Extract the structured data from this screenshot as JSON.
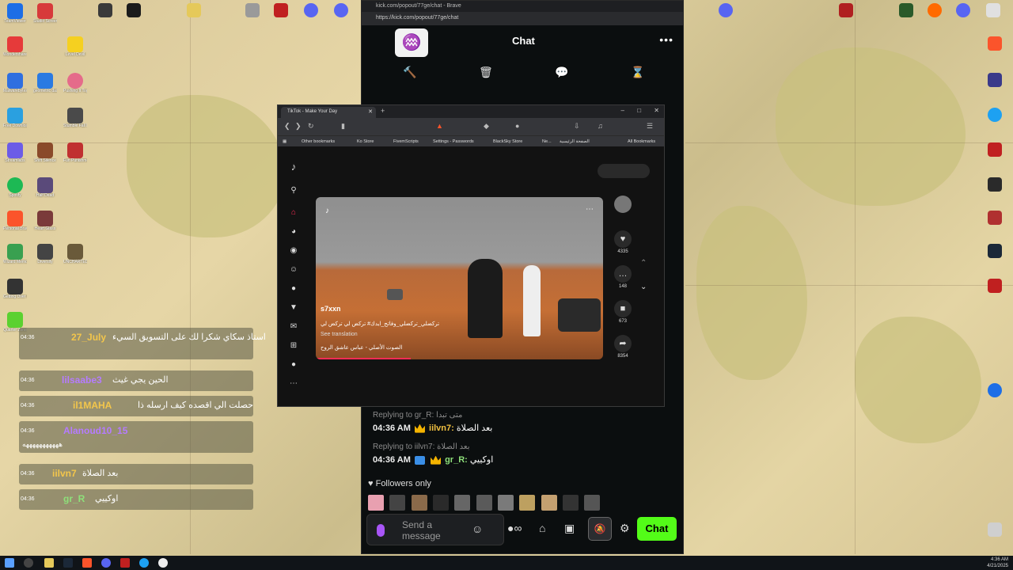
{
  "desktop": {
    "left_icons": [
      {
        "label": "TeamViewer",
        "color": "#1d6ee6"
      },
      {
        "label": "Wondershare PDFelement",
        "color": "#e63a3a"
      },
      {
        "label": "Malwarebytes",
        "color": "#2f6fe0"
      },
      {
        "label": "Free Download",
        "color": "#2aa0e0"
      },
      {
        "label": "Streamlabs",
        "color": "#6c5ce7"
      },
      {
        "label": "Spotify",
        "color": "#1db954"
      },
      {
        "label": "Personal Brave",
        "color": "#fb542b"
      },
      {
        "label": "Wizard Memories",
        "color": "#39a050"
      },
      {
        "label": "Getting Over It with Bennett",
        "color": "#333333"
      },
      {
        "label": "Quarter Zone",
        "color": "#5bd130"
      }
    ],
    "second_icons": [
      {
        "label": "Studio Screen",
        "color": "#d73a3a"
      },
      {
        "label": "Level Devil",
        "color": "#f5d020"
      },
      {
        "label": "geometric dash",
        "color": "#2a7ae2"
      },
      {
        "label": "Pushing It Together",
        "color": "#e56b8a"
      },
      {
        "label": "Stumble Fall Hero",
        "color": "#4a4a4a"
      },
      {
        "label": "Shift Silence",
        "color": "#8a4a2a"
      },
      {
        "label": "Fun Punishment",
        "color": "#c03030"
      },
      {
        "label": "Half Dead",
        "color": "#5a4a7a"
      },
      {
        "label": "Heart Glass",
        "color": "#7a3a3a"
      },
      {
        "label": "Diversity",
        "color": "#444444"
      },
      {
        "label": "UNCHARTED Legacy of",
        "color": "#6a5a3a"
      }
    ]
  },
  "kick": {
    "titlebar": "kick.com/popout/77ge/chat - Brave",
    "url": "https://kick.com/popout/77ge/chat",
    "logo": "♒",
    "chat_title": "Chat",
    "more": "•••",
    "mod_icons": [
      "🔨",
      "🗑",
      "💬",
      "⌛"
    ],
    "messages": [
      {
        "reply": "Replying to gr_R: متى تبدا",
        "time": "04:36 AM",
        "name": "iilvn7:",
        "text": "بعد الصلاة"
      },
      {
        "reply": "Replying to iilvn7: بعد الصلاة",
        "time": "04:36 AM",
        "name": "gr_R:",
        "text": "اوكييي"
      }
    ],
    "followers_only": "Followers only",
    "send_placeholder": "Send a message",
    "chat_button": "Chat"
  },
  "tiktok": {
    "tab_title": "TikTok - Make Your Day",
    "bookmarks": [
      "Other bookmarks",
      "Ko Store",
      "FivemScripts",
      "Settings - Passwords",
      "BlackSky Store",
      "Ne...",
      "الصفحة الرئيسية",
      "All Bookmarks"
    ],
    "video": {
      "username": "s7xxn",
      "caption": "تركضلي_تركضلي_وفاتح_ايدك# تركض لي تركض لي",
      "see_translation": "See translation",
      "music": "الصوت الأصلي - عباس عاشق الروح",
      "progress": 0.33
    },
    "actions": [
      {
        "icon": "♥",
        "count": "4335"
      },
      {
        "icon": "…",
        "count": "148"
      },
      {
        "icon": "■",
        "count": "673"
      },
      {
        "icon": "➦",
        "count": "8354"
      }
    ]
  },
  "overlay": {
    "lines": [
      {
        "time": "04:36",
        "name": "27_July",
        "name_color": "#f3c64b",
        "text": "استاذ سكاي شكرا لك على التسويق السيء"
      },
      {
        "time": "04:36",
        "name": "lilsaabe3",
        "name_color": "#b57bff",
        "text": "الحين يجي غيث"
      },
      {
        "time": "04:36",
        "name": "il1MAHA",
        "name_color": "#f3c64b",
        "text": "حصلت الي اقصده كيف ارسله ذا"
      },
      {
        "time": "04:36",
        "name": "Alanoud10_15",
        "name_color": "#b57bff",
        "text": "هههههههههههه"
      },
      {
        "time": "04:36",
        "name": "iilvn7",
        "name_color": "#f3c64b",
        "text": "بعد الصلاة"
      },
      {
        "time": "04:36",
        "name": "gr_R",
        "name_color": "#8ee07a",
        "text": "اوكييي"
      }
    ]
  },
  "taskbar": {
    "time": "4:36 AM",
    "date": "4/21/2025"
  }
}
